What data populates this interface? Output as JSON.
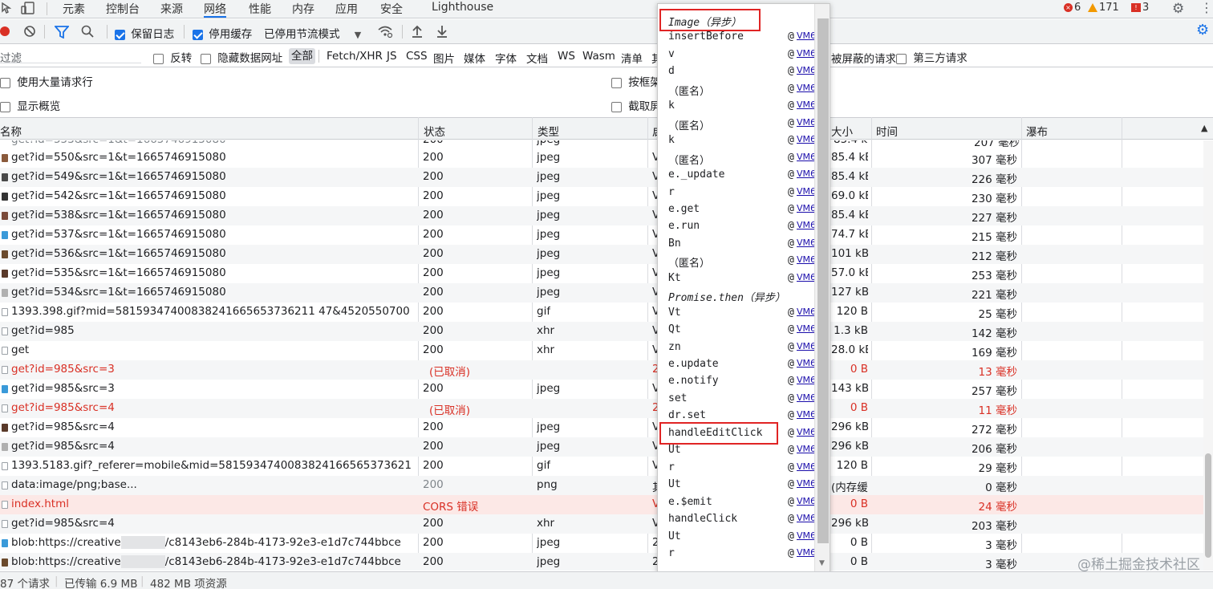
{
  "tabs": [
    "元素",
    "控制台",
    "来源",
    "网络",
    "性能",
    "内存",
    "应用",
    "安全",
    "Lighthouse"
  ],
  "active_tab": "网络",
  "badges": {
    "errors": "6",
    "warnings": "171",
    "issues": "3"
  },
  "toolbar": {
    "preserve_log": "保留日志",
    "disable_cache": "停用缓存",
    "throttle": "已停用节流模式"
  },
  "filter": {
    "placeholder": "过滤",
    "invert": "反转",
    "hide_data_urls": "隐藏数据网址",
    "types": [
      "全部",
      "Fetch/XHR",
      "JS",
      "CSS",
      "图片",
      "媒体",
      "字体",
      "文档",
      "WS",
      "Wasm",
      "清单",
      "其"
    ],
    "blocked_requests": "被屏蔽的请求",
    "third_party": "第三方请求"
  },
  "options": {
    "big_rows": "使用大量请求行",
    "show_overview": "显示概览",
    "group_by_frame": "按框架",
    "capture_screenshots": "截取屏"
  },
  "columns": {
    "name": "名称",
    "status": "状态",
    "type": "类型",
    "initiator": "启",
    "size": "大小",
    "time": "时间",
    "waterfall": "瀑布"
  },
  "rows": [
    {
      "name": "get?id=550&src=1&t=1665746915080",
      "status": "200",
      "type": "jpeg",
      "initiator": "V",
      "size": "85.4 kB",
      "time": "307 毫秒"
    },
    {
      "name": "get?id=549&src=1&t=1665746915080",
      "status": "200",
      "type": "jpeg",
      "initiator": "V",
      "size": "85.4 kB",
      "time": "226 毫秒"
    },
    {
      "name": "get?id=542&src=1&t=1665746915080",
      "status": "200",
      "type": "jpeg",
      "initiator": "V",
      "size": "69.0 kB",
      "time": "230 毫秒"
    },
    {
      "name": "get?id=538&src=1&t=1665746915080",
      "status": "200",
      "type": "jpeg",
      "initiator": "V",
      "size": "85.4 kB",
      "time": "227 毫秒"
    },
    {
      "name": "get?id=537&src=1&t=1665746915080",
      "status": "200",
      "type": "jpeg",
      "initiator": "V",
      "size": "74.7 kB",
      "time": "215 毫秒"
    },
    {
      "name": "get?id=536&src=1&t=1665746915080",
      "status": "200",
      "type": "jpeg",
      "initiator": "V",
      "size": "101 kB",
      "time": "212 毫秒"
    },
    {
      "name": "get?id=535&src=1&t=1665746915080",
      "status": "200",
      "type": "jpeg",
      "initiator": "V",
      "size": "57.0 kB",
      "time": "253 毫秒"
    },
    {
      "name": "get?id=534&src=1&t=1665746915080",
      "status": "200",
      "type": "jpeg",
      "initiator": "V",
      "size": "127 kB",
      "time": "221 毫秒"
    },
    {
      "name": "1393.398.gif?mid=58159347400838241665653736211 47&4520550700",
      "status": "200",
      "type": "gif",
      "initiator": "V",
      "size": "120 B",
      "time": "25 毫秒"
    },
    {
      "name": "get?id=985",
      "status": "200",
      "type": "xhr",
      "initiator": "V",
      "size": "1.3 kB",
      "time": "142 毫秒"
    },
    {
      "name": "get",
      "status": "200",
      "type": "xhr",
      "initiator": "V",
      "size": "28.0 kB",
      "time": "169 毫秒"
    },
    {
      "name": "get?id=985&src=3",
      "status": "(已取消)",
      "type": "",
      "initiator": "2",
      "size": "0 B",
      "time": "13 毫秒",
      "state": "cancelled"
    },
    {
      "name": "get?id=985&src=3",
      "status": "200",
      "type": "jpeg",
      "initiator": "V",
      "size": "143 kB",
      "time": "257 毫秒"
    },
    {
      "name": "get?id=985&src=4",
      "status": "(已取消)",
      "type": "",
      "initiator": "2",
      "size": "0 B",
      "time": "11 毫秒",
      "state": "cancelled"
    },
    {
      "name": "get?id=985&src=4",
      "status": "200",
      "type": "jpeg",
      "initiator": "V",
      "size": "296 kB",
      "time": "272 毫秒"
    },
    {
      "name": "get?id=985&src=4",
      "status": "200",
      "type": "jpeg",
      "initiator": "V",
      "size": "296 kB",
      "time": "206 毫秒"
    },
    {
      "name": "1393.5183.gif?_referer=mobile&mid=5815934740083824166565373621 1147&354...",
      "status": "200",
      "type": "gif",
      "initiator": "V",
      "size": "120 B",
      "time": "29 毫秒"
    },
    {
      "name": "data:image/png;base...",
      "status": "200",
      "type": "png",
      "initiator": "其",
      "size": "(内存缓...",
      "time": "0 毫秒",
      "state": "muted"
    },
    {
      "name": "index.html",
      "status": "CORS 错误",
      "type": "",
      "initiator": "V",
      "size": "0 B",
      "time": "24 毫秒",
      "state": "error"
    },
    {
      "name": "get?id=985&src=4",
      "status": "200",
      "type": "xhr",
      "initiator": "V",
      "size": "296 kB",
      "time": "203 毫秒"
    },
    {
      "name": "blob:https://creative",
      "name_tail": "/c8143eb6-284b-4173-92e3-e1d7c744bbce",
      "status": "200",
      "type": "jpeg",
      "initiator": "2",
      "size": "0 B",
      "time": "3 毫秒"
    },
    {
      "name": "blob:https://creative",
      "name_tail": "/c8143eb6-284b-4173-92e3-e1d7c744bbce",
      "status": "200",
      "type": "jpeg",
      "initiator": "2",
      "size": "0 B",
      "time": "3 毫秒"
    }
  ],
  "call_stack": [
    {
      "fn": "Image（异步）",
      "async": true,
      "highlight": true
    },
    {
      "fn": "insertBefore",
      "link": "VM6"
    },
    {
      "fn": "v",
      "link": "VM6"
    },
    {
      "fn": "d",
      "link": "VM6"
    },
    {
      "fn": "（匿名）",
      "link": "VM6"
    },
    {
      "fn": "k",
      "link": "VM6"
    },
    {
      "fn": "（匿名）",
      "link": "VM6"
    },
    {
      "fn": "k",
      "link": "VM6"
    },
    {
      "fn": "（匿名）",
      "link": "VM6"
    },
    {
      "fn": "e._update",
      "link": "VM6"
    },
    {
      "fn": "r",
      "link": "VM6"
    },
    {
      "fn": "e.get",
      "link": "VM6"
    },
    {
      "fn": "e.run",
      "link": "VM6"
    },
    {
      "fn": "Bn",
      "link": "VM6"
    },
    {
      "fn": "（匿名）",
      "link": "VM6"
    },
    {
      "fn": "Kt",
      "link": "VM6"
    },
    {
      "fn": "Promise.then（异步）",
      "async": true
    },
    {
      "fn": "Vt",
      "link": "VM6"
    },
    {
      "fn": "Qt",
      "link": "VM6"
    },
    {
      "fn": "zn",
      "link": "VM6"
    },
    {
      "fn": "e.update",
      "link": "VM6"
    },
    {
      "fn": "e.notify",
      "link": "VM6"
    },
    {
      "fn": "set",
      "link": "VM6"
    },
    {
      "fn": "dr.set",
      "link": "VM6"
    },
    {
      "fn": "handleEditClick",
      "link": "VM6",
      "highlight": true
    },
    {
      "fn": "Ut",
      "link": "VM6"
    },
    {
      "fn": "r",
      "link": "VM6"
    },
    {
      "fn": "Ut",
      "link": "VM6"
    },
    {
      "fn": "e.$emit",
      "link": "VM6"
    },
    {
      "fn": "handleClick",
      "link": "VM6"
    },
    {
      "fn": "Ut",
      "link": "VM6"
    },
    {
      "fn": "r",
      "link": "VM6"
    }
  ],
  "status_bar": {
    "requests": "87 个请求",
    "transferred": "已传输 6.9 MB",
    "resources": "482 MB 项资源"
  },
  "watermark": "@稀土掘金技术社区",
  "colors": {
    "accent": "#1a73e8",
    "error": "#d93025",
    "highlight_box": "#e02424",
    "error_row": "#fce8e6"
  }
}
